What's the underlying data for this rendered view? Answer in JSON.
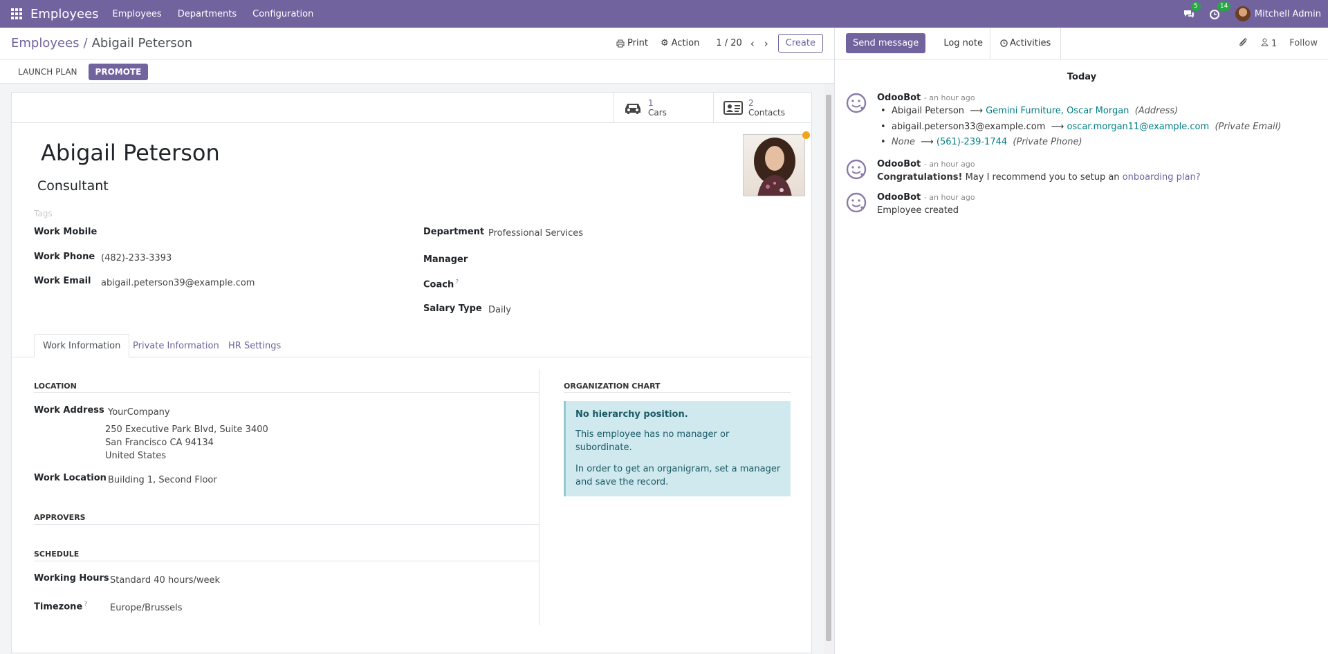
{
  "navbar": {
    "app_name": "Employees",
    "menu": [
      "Employees",
      "Departments",
      "Configuration"
    ],
    "messages_count": "5",
    "activities_count": "14",
    "user_name": "Mitchell Admin",
    "color": "#71639e"
  },
  "control": {
    "breadcrumb_parent": "Employees",
    "breadcrumb_sep": "/",
    "breadcrumb_current": "Abigail Peterson",
    "print_label": "Print",
    "action_label": "Action",
    "pager": "1 / 20",
    "create_label": "Create"
  },
  "statusbar": {
    "launch_plan": "LAUNCH PLAN",
    "promote": "PROMOTE"
  },
  "stat_buttons": {
    "cars": {
      "count": "1",
      "label": "Cars"
    },
    "contacts": {
      "count": "2",
      "label": "Contacts"
    }
  },
  "employee": {
    "name": "Abigail Peterson",
    "job_title": "Consultant",
    "tags_placeholder": "Tags",
    "work_mobile_label": "Work Mobile",
    "work_mobile": "",
    "work_phone_label": "Work Phone",
    "work_phone": "(482)-233-3393",
    "work_email_label": "Work Email",
    "work_email": "abigail.peterson39@example.com",
    "department_label": "Department",
    "department": "Professional Services",
    "manager_label": "Manager",
    "coach_label": "Coach",
    "salary_type_label": "Salary Type",
    "salary_type": "Daily"
  },
  "tabs": [
    "Work Information",
    "Private Information",
    "HR Settings"
  ],
  "work_info": {
    "location_title": "LOCATION",
    "work_address_label": "Work Address",
    "address_company": "YourCompany",
    "address_street": "250 Executive Park Blvd, Suite 3400",
    "address_city": "San Francisco CA 94134",
    "address_country": "United States",
    "work_location_label": "Work Location",
    "work_location": "Building 1, Second Floor",
    "approvers_title": "APPROVERS",
    "schedule_title": "SCHEDULE",
    "working_hours_label": "Working Hours",
    "working_hours": "Standard 40 hours/week",
    "timezone_label": "Timezone",
    "timezone": "Europe/Brussels",
    "org_chart_title": "ORGANIZATION CHART",
    "org_no_position": "No hierarchy position.",
    "org_no_manager": "This employee has no manager or subordinate.",
    "org_hint": "In order to get an organigram, set a manager and save the record."
  },
  "chatter": {
    "send_message": "Send message",
    "log_note": "Log note",
    "activities": "Activities",
    "followers_count": "1",
    "follow": "Follow",
    "today": "Today",
    "messages": [
      {
        "author": "OdooBot",
        "date": "- an hour ago",
        "changes": [
          {
            "old": "Abigail Peterson",
            "new": "Gemini Furniture, Oscar Morgan",
            "field": "(Address)"
          },
          {
            "old": "abigail.peterson33@example.com",
            "new": "oscar.morgan11@example.com",
            "field": "(Private Email)"
          },
          {
            "old": "None",
            "new": "(561)-239-1744",
            "field": "(Private Phone)"
          }
        ]
      },
      {
        "author": "OdooBot",
        "date": "- an hour ago",
        "body_bold": "Congratulations!",
        "body": " May I recommend you to setup an ",
        "body_link": "onboarding plan?"
      },
      {
        "author": "OdooBot",
        "date": "- an hour ago",
        "body": "Employee created"
      }
    ]
  }
}
